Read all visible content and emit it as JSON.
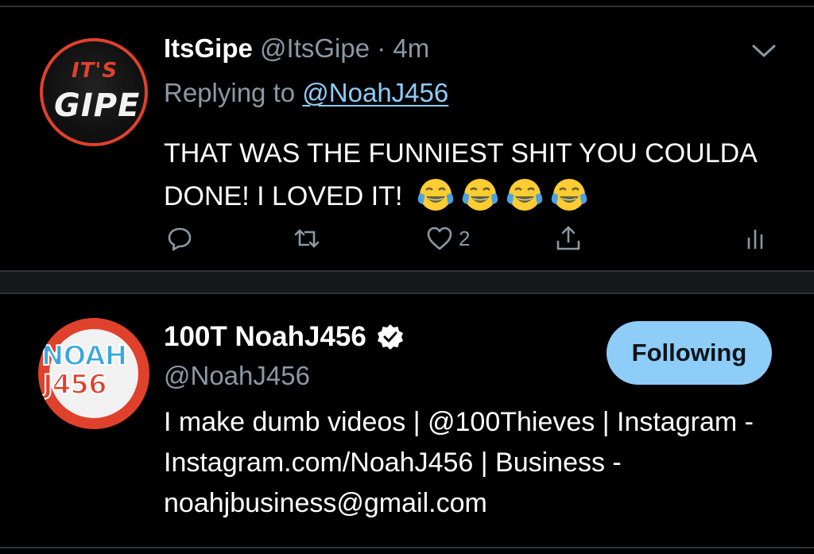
{
  "tweet": {
    "avatar_text_line1": "IT'S",
    "avatar_text_line2": "GIPE",
    "author_name": "ItsGipe",
    "author_handle": "@ItsGipe",
    "separator": "·",
    "time": "4m",
    "replying_prefix": "Replying to",
    "replying_mention": "@NoahJ456",
    "text": "THAT WAS THE FUNNIEST SHIT YOU COULDA DONE! I LOVED IT!",
    "emoji_name": "face-with-tears-of-joy",
    "emoji_count": 4,
    "actions": {
      "like_count": "2"
    },
    "icons": [
      "chevron-down-icon",
      "reply-icon",
      "retweet-icon",
      "heart-icon",
      "share-icon",
      "analytics-icon"
    ]
  },
  "profile": {
    "avatar_text_line1": "NOAH",
    "avatar_text_line2": "J456",
    "name": "100T NoahJ456",
    "verified_icon": "verified-badge-icon",
    "handle": "@NoahJ456",
    "follow_label": "Following",
    "bio": "I make dumb videos | @100Thieves | Instagram - Instagram.com/NoahJ456 | Business - noahjbusiness@gmail.com"
  },
  "colors": {
    "background": "#000000",
    "secondary_text": "#8b98a5",
    "link": "#8ecdf8",
    "accent_red": "#e0412c",
    "follow_button": "#8ecdf8",
    "divider": "#16181c"
  }
}
